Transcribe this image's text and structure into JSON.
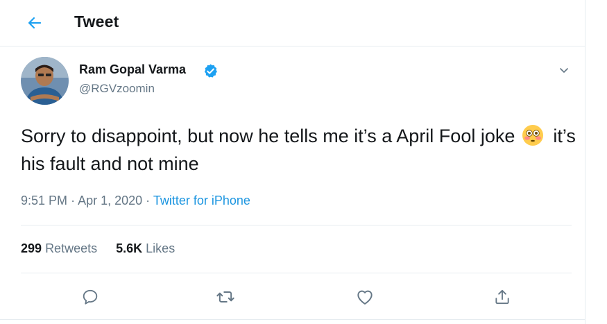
{
  "header": {
    "title": "Tweet",
    "back_icon": "back-arrow-icon"
  },
  "tweet": {
    "author_name": "Ram Gopal Varma",
    "handle": "@RGVzoomin",
    "verified": true,
    "text_part1": "Sorry to disappoint, but now he tells me it’s a April Fool joke",
    "emoji": "😳",
    "text_part2": "it’s his fault and not mine",
    "time": "9:51 PM",
    "separator": "·",
    "date": "Apr 1, 2020",
    "source": "Twitter for iPhone"
  },
  "stats": {
    "retweets_count": "299",
    "retweets_label": "Retweets",
    "likes_count": "5.6K",
    "likes_label": "Likes"
  },
  "actions": [
    "reply-icon",
    "retweet-icon",
    "like-icon",
    "share-icon"
  ],
  "colors": {
    "accent": "#1DA1F2",
    "link": "#1B95E0",
    "secondary_text": "#657786",
    "divider": "#E6ECF0"
  }
}
